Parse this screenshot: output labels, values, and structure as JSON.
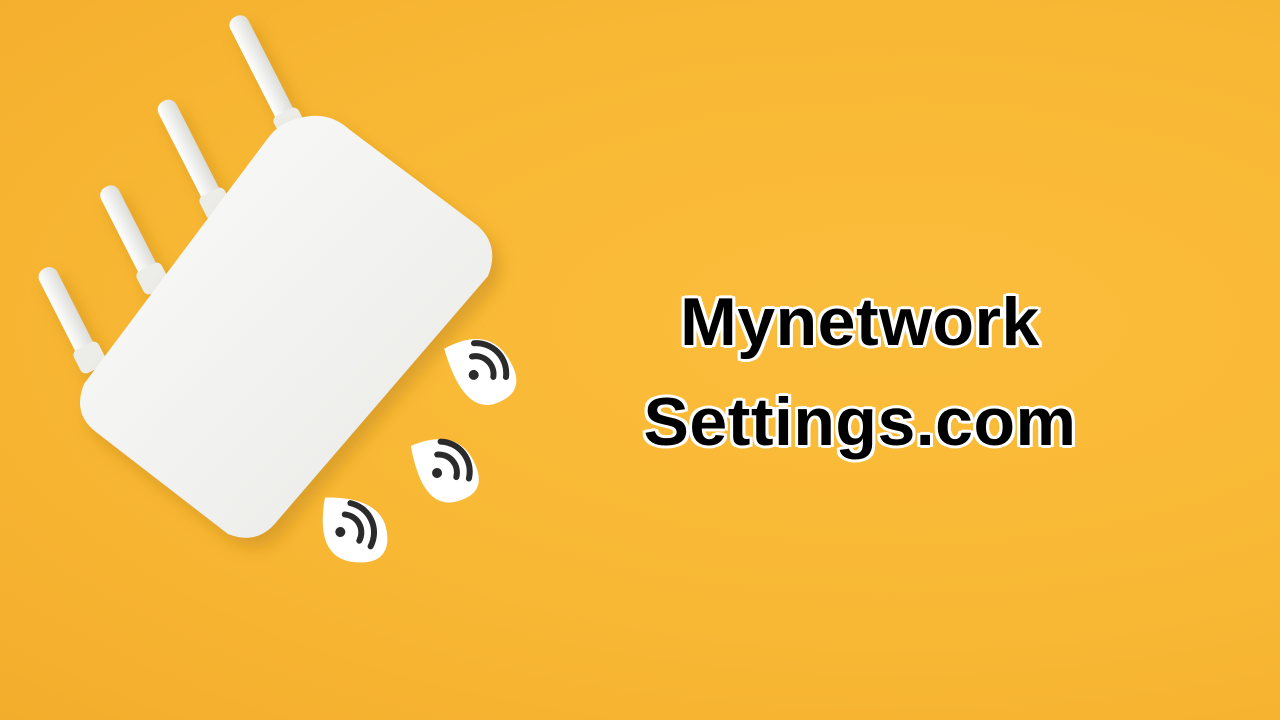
{
  "brand": {
    "line1": "Mynetwork",
    "line2": "Settings.com"
  },
  "colors": {
    "background": "#f8b834",
    "router": "#f4f4f2",
    "text": "#000000",
    "text_outline": "#ffffff"
  },
  "icons": [
    "router-illustration",
    "wifi-signal-icon",
    "wifi-signal-icon",
    "wifi-signal-icon"
  ]
}
